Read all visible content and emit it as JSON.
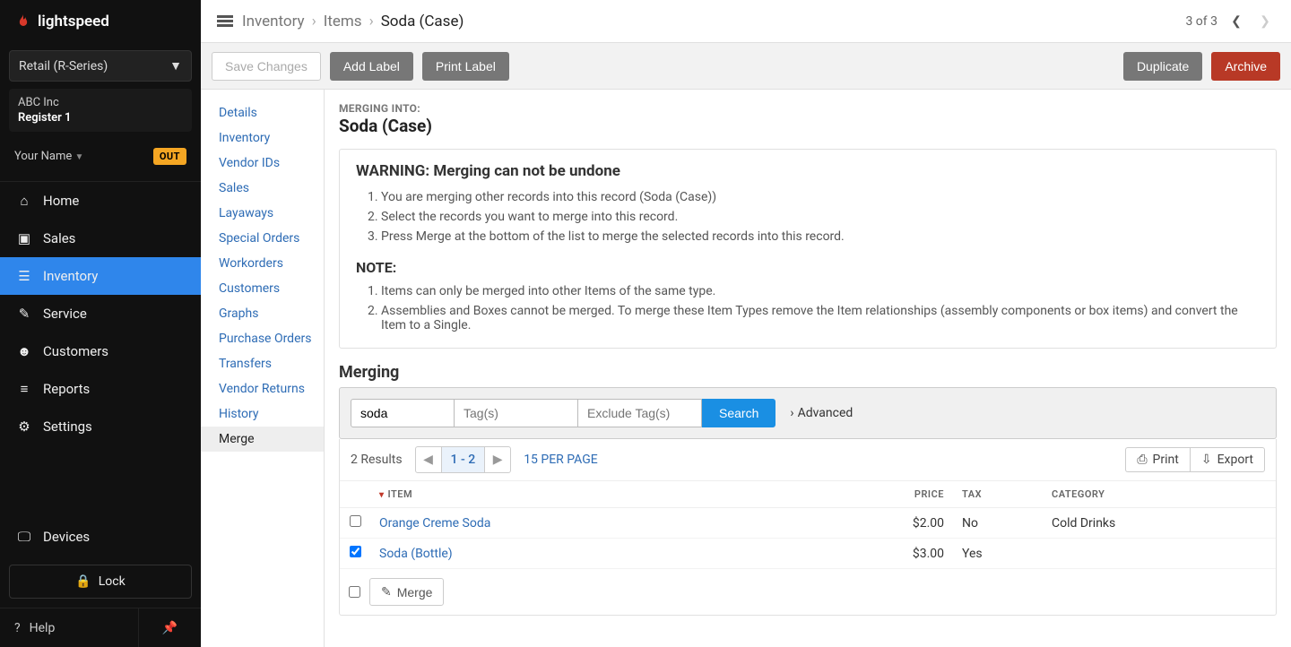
{
  "brand": "lightspeed",
  "product": {
    "name": "Retail (R-Series)"
  },
  "org": {
    "company": "ABC Inc",
    "register": "Register 1"
  },
  "user": {
    "name": "Your Name",
    "badge": "OUT"
  },
  "nav": {
    "home": "Home",
    "sales": "Sales",
    "inventory": "Inventory",
    "service": "Service",
    "customers": "Customers",
    "reports": "Reports",
    "settings": "Settings",
    "devices": "Devices",
    "lock": "Lock",
    "help": "Help"
  },
  "breadcrumb": {
    "a": "Inventory",
    "b": "Items",
    "c": "Soda (Case)"
  },
  "pagepos": "3 of 3",
  "toolbar": {
    "save": "Save Changes",
    "addlabel": "Add Label",
    "printlabel": "Print Label",
    "duplicate": "Duplicate",
    "archive": "Archive"
  },
  "subnav": {
    "details": "Details",
    "inventory": "Inventory",
    "vendorids": "Vendor IDs",
    "sales": "Sales",
    "layaways": "Layaways",
    "specialorders": "Special Orders",
    "workorders": "Workorders",
    "customers": "Customers",
    "graphs": "Graphs",
    "purchaseorders": "Purchase Orders",
    "transfers": "Transfers",
    "vendorreturns": "Vendor Returns",
    "history": "History",
    "merge": "Merge"
  },
  "merge": {
    "label": "MERGING INTO:",
    "target": "Soda (Case)",
    "warn_title": "WARNING: Merging can not be undone",
    "warn1": "You are merging other records into this record (Soda (Case))",
    "warn2": "Select the records you want to merge into this record.",
    "warn3": "Press Merge at the bottom of the list to merge the selected records into this record.",
    "note_title": "NOTE:",
    "note1": "Items can only be merged into other Items of the same type.",
    "note2": "Assemblies and Boxes cannot be merged. To merge these Item Types remove the Item relationships (assembly components or box items) and convert the Item to a Single.",
    "section": "Merging"
  },
  "search": {
    "value": "soda",
    "tags_ph": "Tag(s)",
    "extags_ph": "Exclude Tag(s)",
    "btn": "Search",
    "advanced": "Advanced"
  },
  "results": {
    "count": "2 Results",
    "range": "1 - 2",
    "perpage": "15 PER PAGE",
    "print": "Print",
    "export": "Export",
    "cols": {
      "item": "ITEM",
      "price": "PRICE",
      "tax": "TAX",
      "category": "CATEGORY"
    },
    "rows": [
      {
        "name": "Orange Creme Soda",
        "price": "$2.00",
        "tax": "No",
        "category": "Cold Drinks",
        "checked": false
      },
      {
        "name": "Soda (Bottle)",
        "price": "$3.00",
        "tax": "Yes",
        "category": "",
        "checked": true
      }
    ],
    "mergebtn": "Merge"
  }
}
